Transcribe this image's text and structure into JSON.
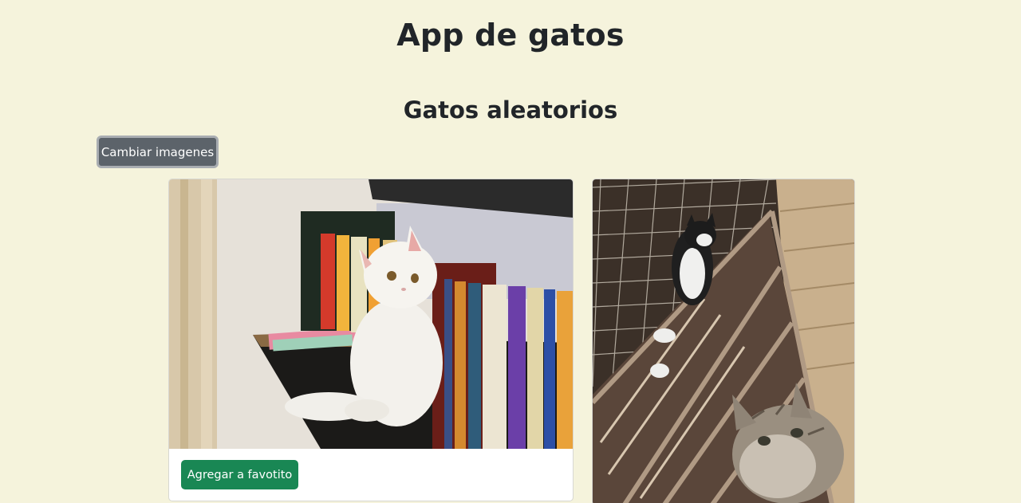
{
  "header": {
    "title": "App de gatos"
  },
  "random_section": {
    "title": "Gatos aleatorios",
    "change_button_label": "Cambiar imagenes"
  },
  "cards": [
    {
      "button_label": "Agregar a favotito"
    },
    {
      "button_label": ""
    }
  ],
  "colors": {
    "background": "#f5f3dc",
    "secondary_button": "#5c636a",
    "success_button": "#198754"
  }
}
